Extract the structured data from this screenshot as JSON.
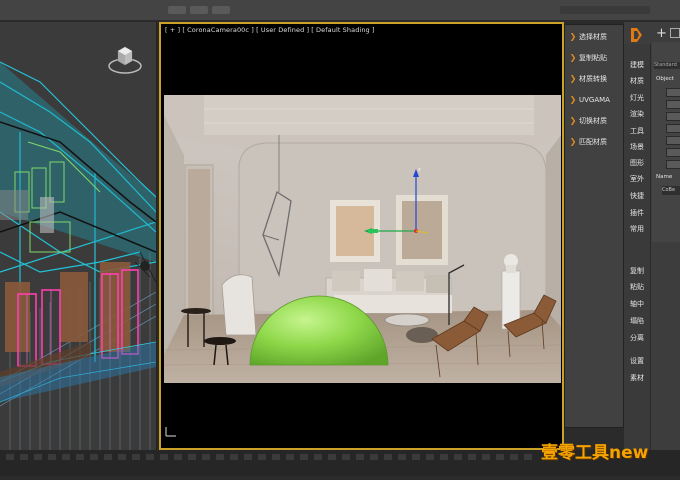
{
  "viewport": {
    "label": "[ + ] [ CoronaCamera00c ] [ User Defined ] [ Default Shading ]"
  },
  "float_panel": {
    "items": [
      {
        "label": "选择材质"
      },
      {
        "label": "复制粘贴"
      },
      {
        "label": "材质转换"
      },
      {
        "label": "UVGAMA"
      },
      {
        "label": "切换材质"
      },
      {
        "label": "匹配材质"
      }
    ]
  },
  "command_panel": {
    "tabs_top": [
      "建模",
      "材质",
      "灯光",
      "渲染",
      "工具",
      "场景",
      "图形",
      "室外",
      "快捷",
      "插件",
      "常用"
    ],
    "tabs_bottom": [
      "复制",
      "粘贴",
      "轴中",
      "塌陷",
      "分离",
      "设置",
      "素材"
    ],
    "standard_label": "Standard",
    "object_type_label": "Object",
    "name_label": "Name",
    "name_value": "CoBe"
  },
  "watermark": "壹零工具new",
  "icons": [
    "plus-icon",
    "modify-icon",
    "sphere-icon",
    "arrow-icon",
    "viewcube-icon",
    "axis-gizmo-icon"
  ]
}
